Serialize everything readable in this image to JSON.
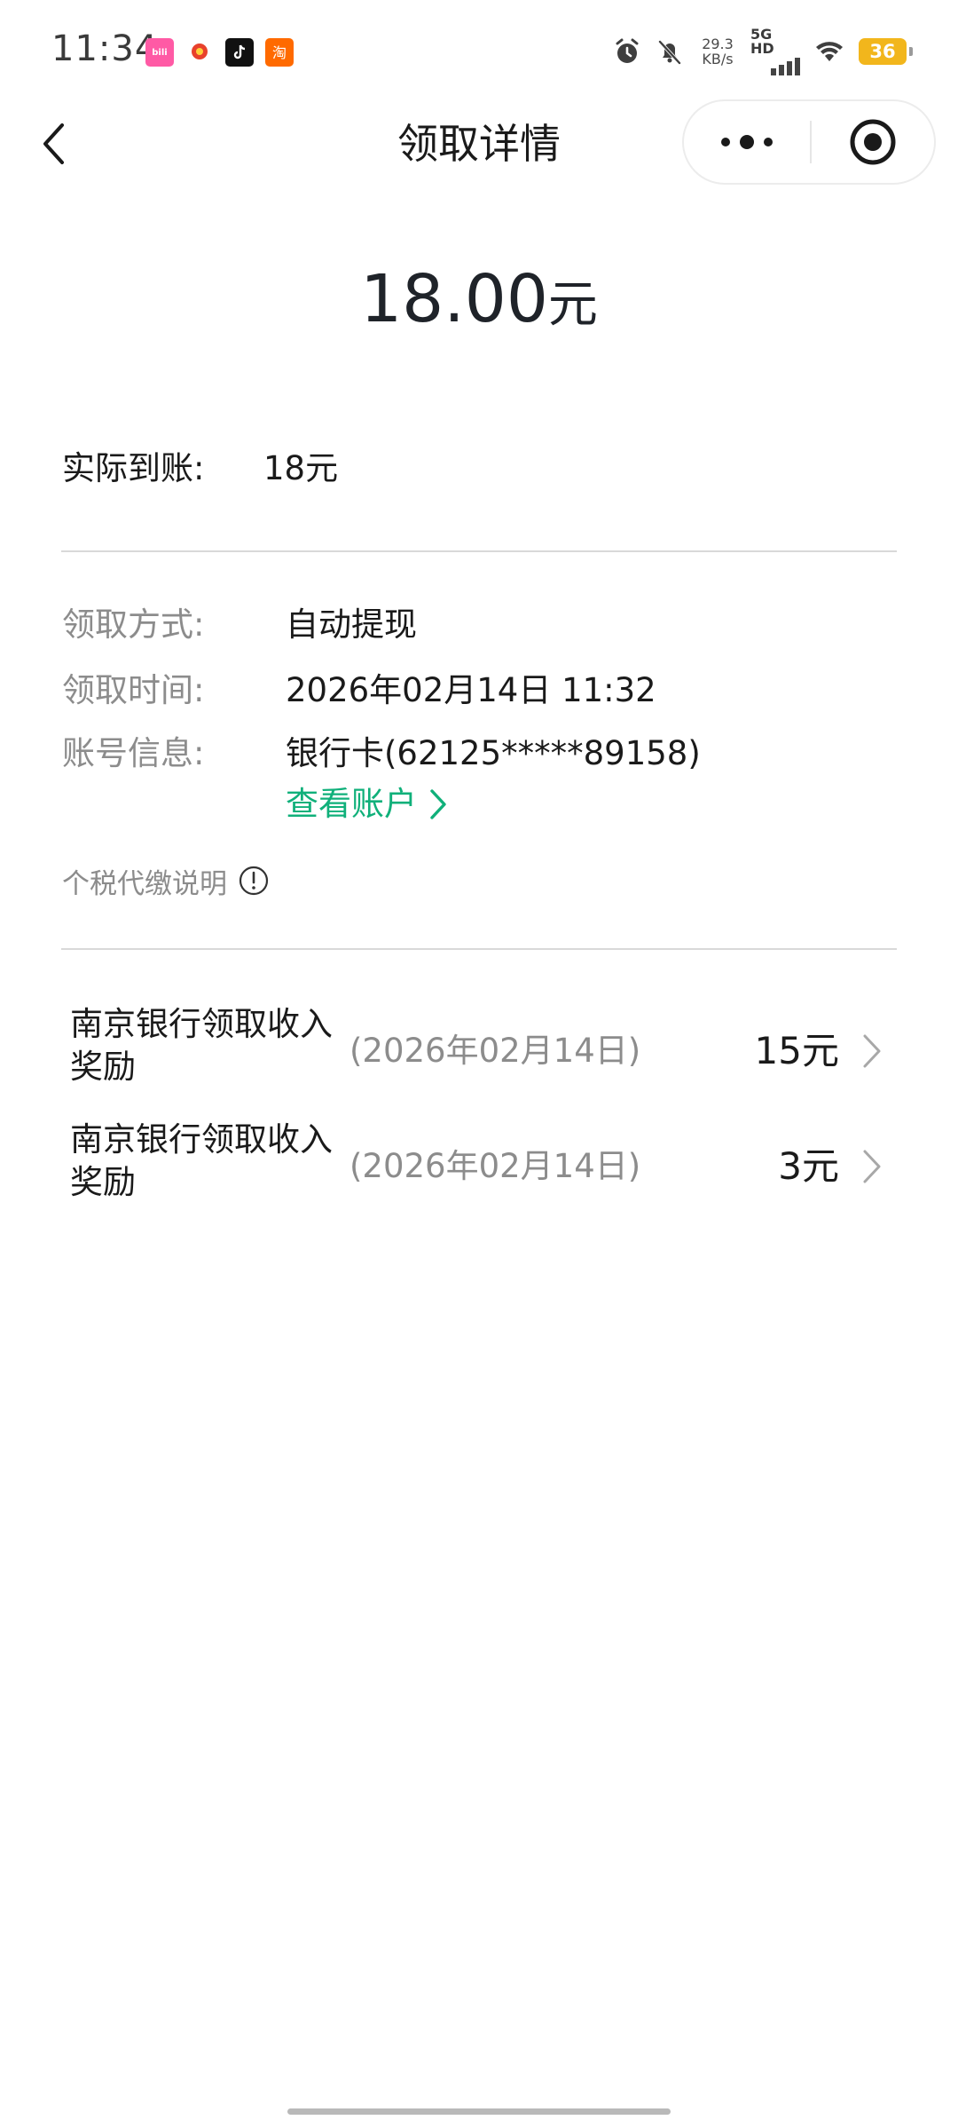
{
  "status_bar": {
    "time": "11:34",
    "app_icons": [
      "bilibili-icon",
      "taobao-special-icon",
      "tiktok-icon",
      "taobao-icon"
    ],
    "net_speed_value": "29.3",
    "net_speed_unit": "KB/s",
    "network_type": "5G HD",
    "battery": "36",
    "battery_color": "#f2b61c"
  },
  "nav": {
    "title": "领取详情"
  },
  "amount": {
    "value": "18.00",
    "unit": "元"
  },
  "actual": {
    "label": "实际到账:",
    "value": "18元"
  },
  "details": {
    "method_label": "领取方式:",
    "method_value": "自动提现",
    "time_label": "领取时间:",
    "time_value": "2026年02月14日 11:32",
    "account_label": "账号信息:",
    "account_value": "银行卡(62125*****89158)",
    "view_account": "查看账户",
    "link_color": "#10b07a"
  },
  "tax_note": "个税代缴说明",
  "income_items": [
    {
      "title": "南京银行领取收入奖励",
      "date": "(2026年02月14日)",
      "amount": "15元"
    },
    {
      "title": "南京银行领取收入奖励",
      "date": "(2026年02月14日)",
      "amount": "3元"
    }
  ]
}
